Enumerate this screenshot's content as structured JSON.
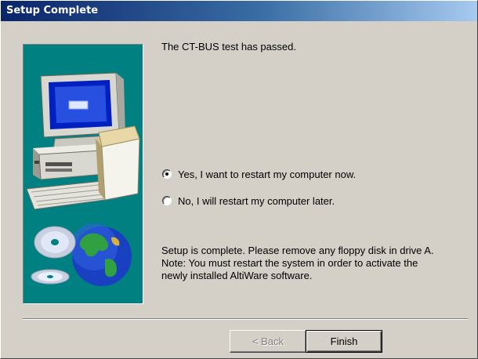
{
  "window": {
    "title": "Setup Complete"
  },
  "main": {
    "status_text": "The CT-BUS test has passed.",
    "options": [
      {
        "label": "Yes, I want to restart my computer now.",
        "checked": true
      },
      {
        "label": "No, I will restart my computer later.",
        "checked": false
      }
    ],
    "message_lines": [
      "Setup is complete. Please remove any floppy disk in drive A.",
      "Note: You must restart the system in order to activate the",
      "newly installed AltiWare software."
    ]
  },
  "buttons": {
    "back_label": "< Back",
    "finish_label": "Finish"
  },
  "colors": {
    "title_start": "#0a246a",
    "title_end": "#a6caf0",
    "panel": "#008080",
    "face": "#d4d0c8"
  },
  "icons": [
    "computer-illustration",
    "cd-discs-icon",
    "globe-icon"
  ]
}
